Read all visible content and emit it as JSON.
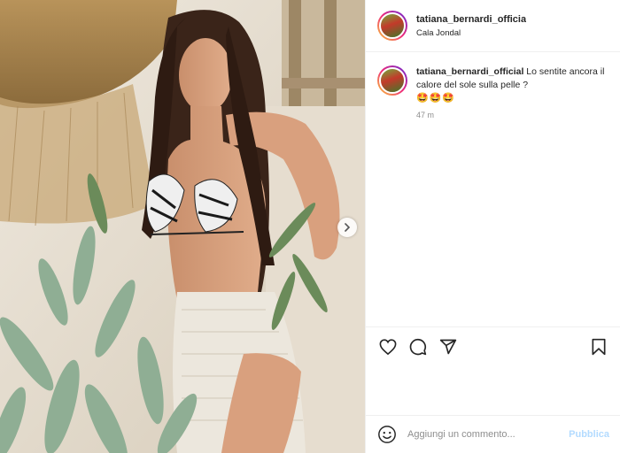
{
  "post": {
    "username": "tatiana_bernardi_official",
    "location": "Cala Jondal",
    "caption_username": "tatiana_bernardi_official",
    "caption_text": "Lo sentite ancora il calore del sole sulla pelle ?",
    "caption_emojis": "🤩🤩🤩",
    "timestamp": "47 m"
  },
  "comment_bar": {
    "placeholder": "Aggiungi un commento...",
    "publish_label": "Pubblica"
  },
  "icons": {
    "like": "heart-icon",
    "comment": "comment-icon",
    "share": "paper-plane-icon",
    "save": "bookmark-icon",
    "emoji": "smiley-icon",
    "next": "chevron-right-icon"
  },
  "colors": {
    "publish_disabled": "#b3dbff",
    "muted": "#8e8e8e",
    "text": "#262626",
    "border": "#efefef"
  }
}
